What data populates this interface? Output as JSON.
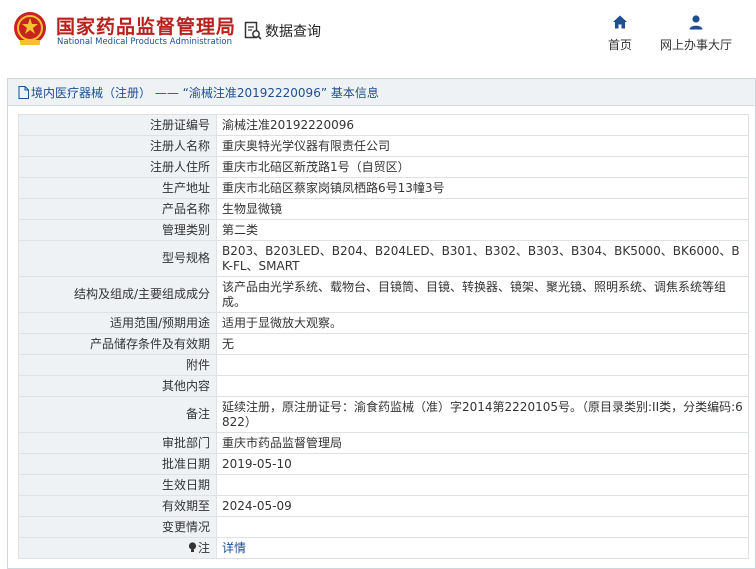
{
  "header": {
    "brand_cn": "国家药品监督管理局",
    "brand_en": "National Medical Products Administration",
    "query_label": "数据查询",
    "nav": [
      {
        "label": "首页",
        "icon": "home-icon"
      },
      {
        "label": "网上办事大厅",
        "icon": "user-icon"
      }
    ]
  },
  "panel": {
    "title": "境内医疗器械（注册） —— “渝械注准20192220096” 基本信息"
  },
  "rows": [
    {
      "label": "注册证编号",
      "value": "渝械注准20192220096"
    },
    {
      "label": "注册人名称",
      "value": "重庆奥特光学仪器有限责任公司"
    },
    {
      "label": "注册人住所",
      "value": "重庆市北碚区新茂路1号（自贸区）"
    },
    {
      "label": "生产地址",
      "value": "重庆市北碚区蔡家岗镇凤栖路6号13幢3号"
    },
    {
      "label": "产品名称",
      "value": "生物显微镜"
    },
    {
      "label": "管理类别",
      "value": "第二类"
    },
    {
      "label": "型号规格",
      "value": "B203、B203LED、B204、B204LED、B301、B302、B303、B304、BK5000、BK6000、BK-FL、SMART"
    },
    {
      "label": "结构及组成/主要组成成分",
      "value": "该产品由光学系统、载物台、目镜筒、目镜、转换器、镜架、聚光镜、照明系统、调焦系统等组成。"
    },
    {
      "label": "适用范围/预期用途",
      "value": "适用于显微放大观察。"
    },
    {
      "label": "产品储存条件及有效期",
      "value": "无"
    },
    {
      "label": "附件",
      "value": ""
    },
    {
      "label": "其他内容",
      "value": ""
    },
    {
      "label": "备注",
      "value": "延续注册，原注册证号：渝食药监械（准）字2014第2220105号。（原目录类别:II类，分类编码:6822）"
    },
    {
      "label": "审批部门",
      "value": "重庆市药品监督管理局"
    },
    {
      "label": "批准日期",
      "value": "2019-05-10"
    },
    {
      "label": "生效日期",
      "value": ""
    },
    {
      "label": "有效期至",
      "value": "2024-05-09"
    },
    {
      "label": "变更情况",
      "value": ""
    },
    {
      "label": "注",
      "value": "详情"
    }
  ],
  "colors": {
    "brand_red": "#b8211e",
    "brand_blue": "#1d4f91",
    "label_bg": "#eef2f5",
    "border": "#dde2e7"
  }
}
